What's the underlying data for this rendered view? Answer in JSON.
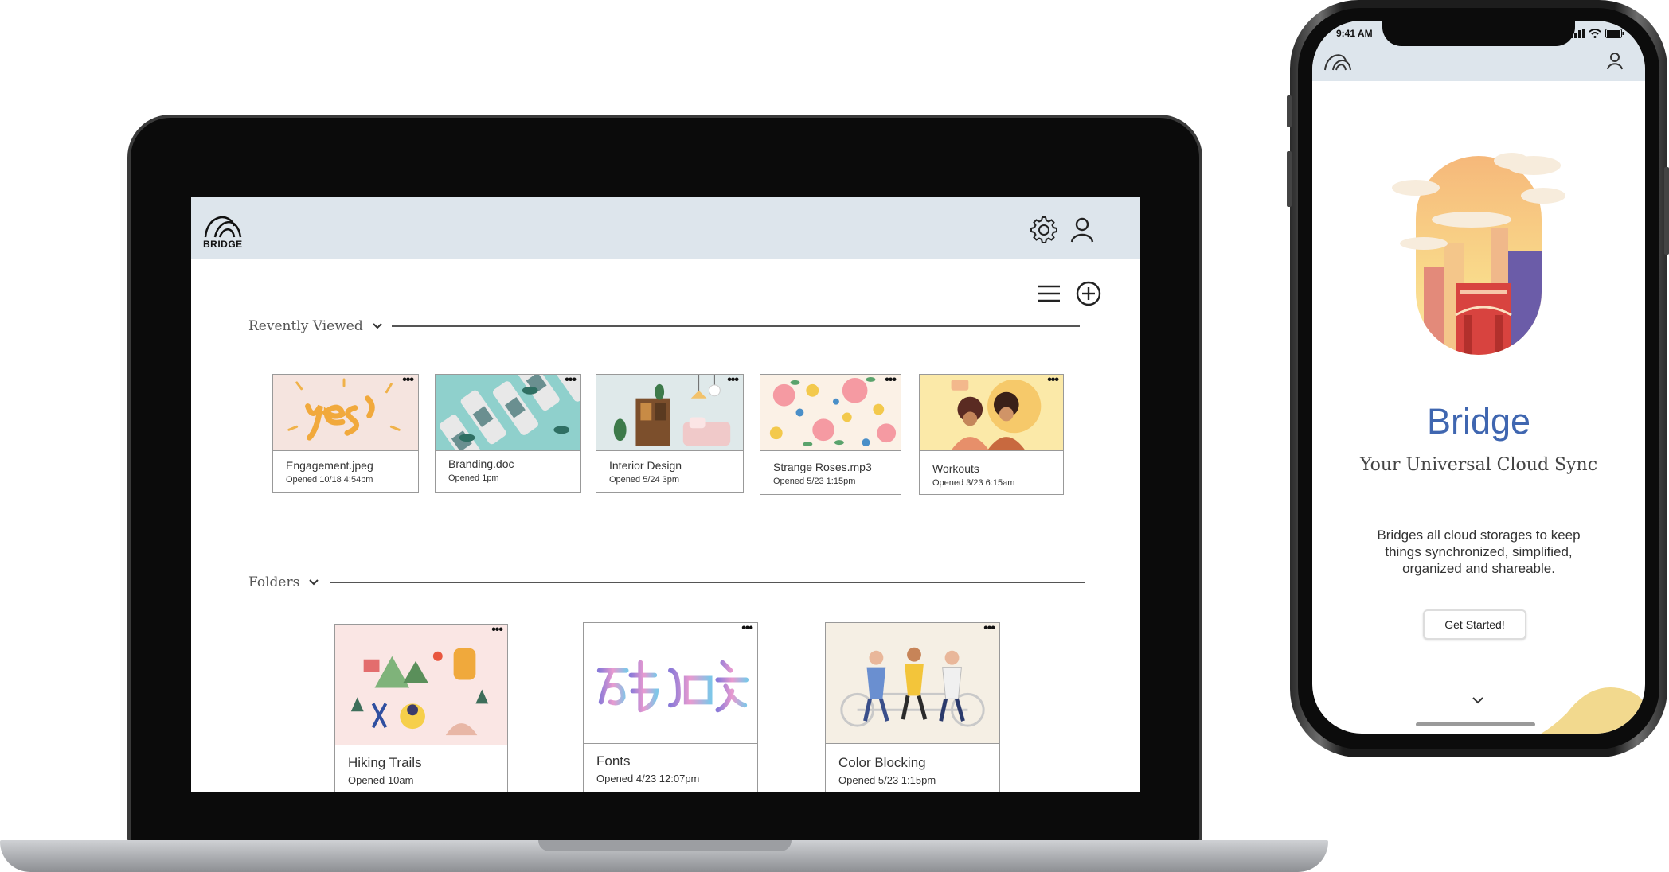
{
  "laptop": {
    "logo_text": "BRIDGE",
    "recent_section": {
      "label": "Revently Viewed"
    },
    "recent_files": [
      {
        "name": "Engagement.jpeg",
        "opened": "Opened 10/18 4:54pm",
        "thumb": "yes-lettering-image"
      },
      {
        "name": "Branding.doc",
        "opened": "Opened 1pm",
        "thumb": "bottles-image"
      },
      {
        "name": "Interior Design",
        "opened": "Opened 5/24 3pm",
        "thumb": "interior-image"
      },
      {
        "name": "Strange Roses.mp3",
        "opened": "Opened 5/23  1:15pm",
        "thumb": "floral-pattern-image"
      },
      {
        "name": "Workouts",
        "opened": "Opened 3/23  6:15am",
        "thumb": "workout-illustration"
      }
    ],
    "folders_section": {
      "label": "Folders"
    },
    "folders": [
      {
        "name": "Hiking Trails",
        "opened": "Opened 10am",
        "thumb": "hiking-illustration"
      },
      {
        "name": "Fonts",
        "opened": "Opened 4/23 12:07pm",
        "thumb": "calligraphy-image"
      },
      {
        "name": "Color Blocking",
        "opened": "Opened 5/23  1:15pm",
        "thumb": "tandem-bike-illustration"
      }
    ],
    "icons": {
      "settings": "gear-icon",
      "profile": "user-icon",
      "list_view": "menu-icon",
      "add": "plus-circle-icon",
      "more": "more-dots-icon",
      "collapse": "chevron-down-icon"
    }
  },
  "phone": {
    "status_time": "9:41 AM",
    "title": "Bridge",
    "subtitle": "Your Universal Cloud Sync",
    "description": "Bridges all cloud storages to keep things synchronized, simplified, organized and shareable.",
    "cta_label": "Get Started!",
    "icons": {
      "logo": "bridge-logo-icon",
      "profile": "user-icon",
      "scroll": "chevron-down-icon"
    }
  },
  "colors": {
    "header_bg": "#dde5ec",
    "brand_blue": "#3f66b0",
    "accent_yellow": "#f2d98e"
  }
}
